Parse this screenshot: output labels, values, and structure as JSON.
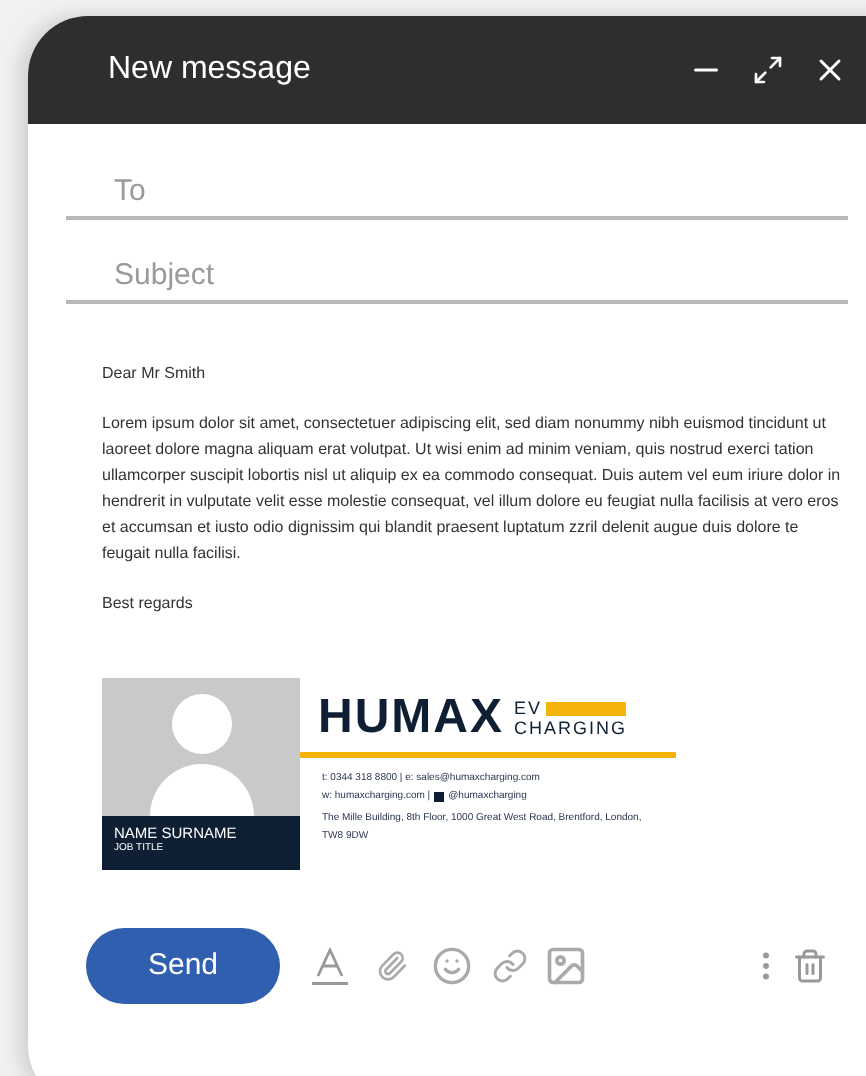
{
  "window": {
    "title": "New message"
  },
  "fields": [
    {
      "placeholder": "To"
    },
    {
      "placeholder": "Subject"
    }
  ],
  "body": {
    "greeting": "Dear Mr Smith",
    "paragraph": "Lorem ipsum dolor sit amet, consectetuer adipiscing elit, sed diam nonummy nibh euismod tincidunt ut laoreet dolore magna aliquam erat volutpat. Ut wisi enim ad minim veniam, quis nostrud exerci tation ullamcorper suscipit lobortis nisl ut aliquip ex ea commodo consequat. Duis autem vel eum iriure dolor in hendrerit in vulputate velit esse molestie consequat, vel illum dolore eu feugiat nulla facilisis at vero eros et accumsan et iusto odio dignissim qui blandit praesent luptatum zzril delenit augue duis dolore te feugait nulla facilisi.",
    "closing": "Best regards"
  },
  "signature": {
    "name": "NAME SURNAME",
    "job_title": "JOB TITLE",
    "logo_word": "HUMAX",
    "logo_ev": "EV",
    "logo_charging": "CHARGING",
    "contact_line": "t: 0344 318 8800 | e: sales@humaxcharging.com",
    "web_line": "w: humaxcharging.com |",
    "social": "@humaxcharging",
    "address": "The Mille Building, 8th Floor, 1000 Great West Road, Brentford, London, TW8 9DW"
  },
  "send_button": "Send"
}
